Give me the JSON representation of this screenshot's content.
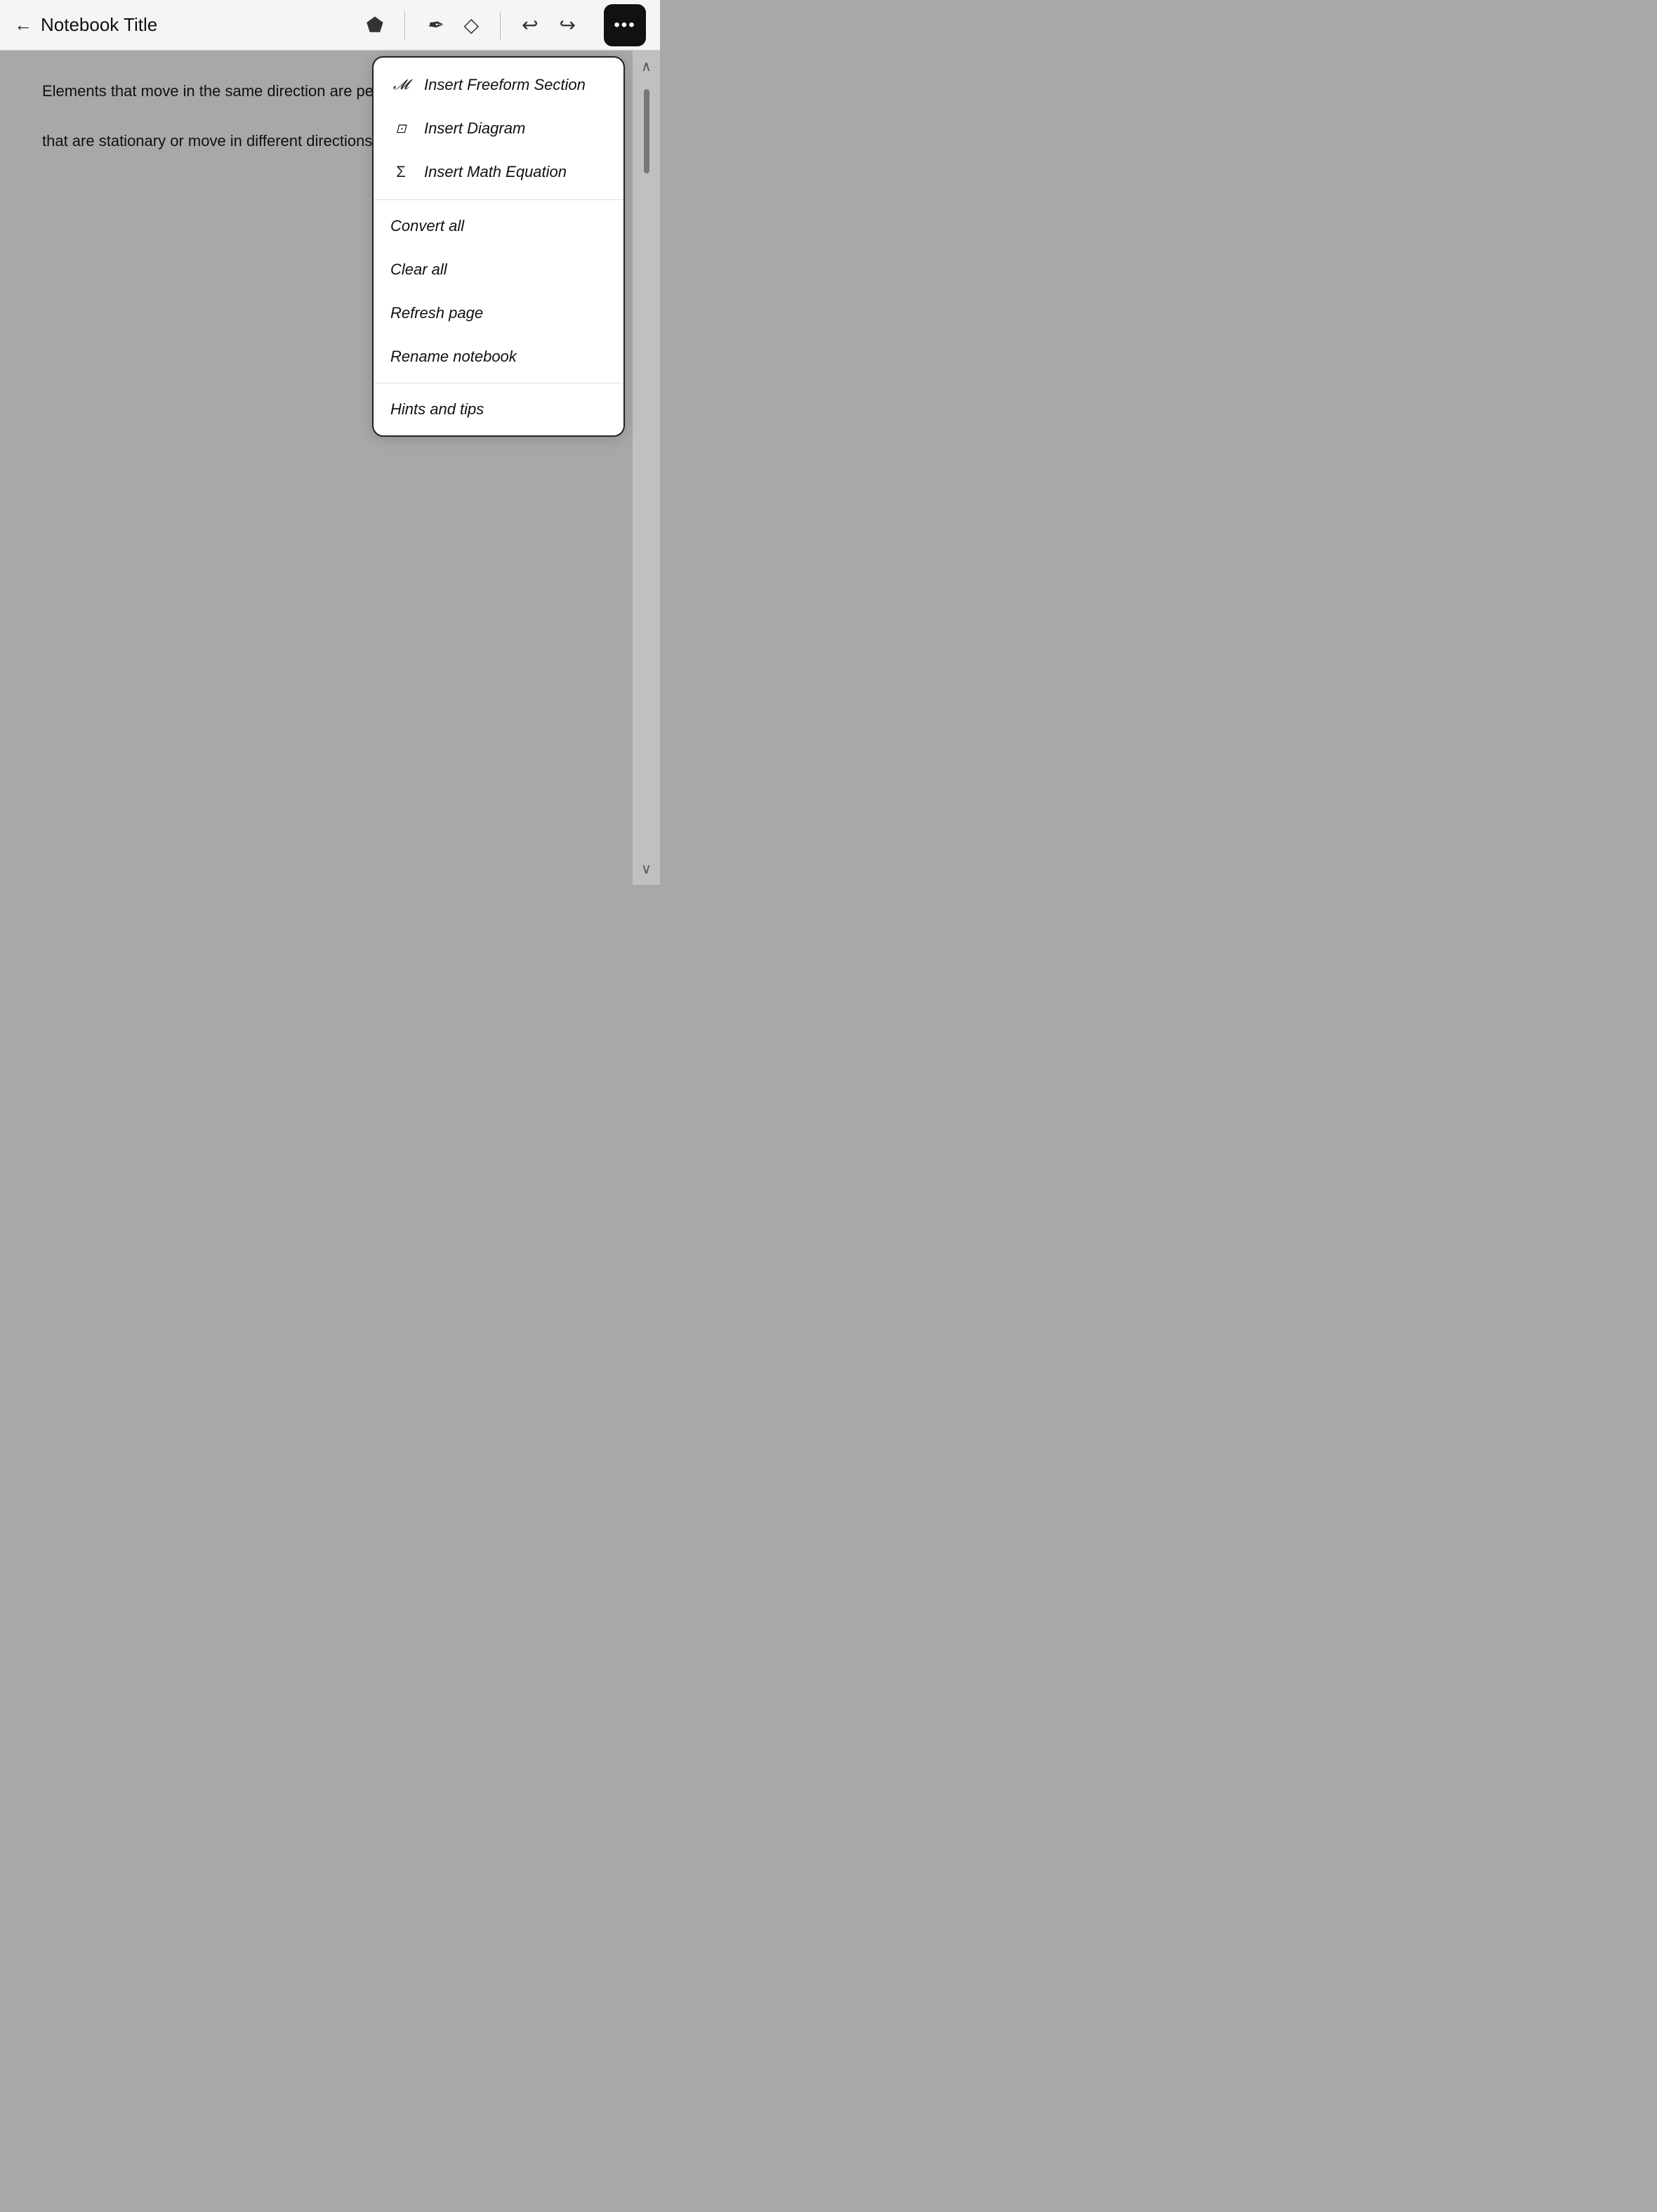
{
  "header": {
    "back_label": "←",
    "title": "Notebook Title",
    "more_dots": "•••"
  },
  "tools": {
    "pen_icon": "✒",
    "eraser_icon": "◇",
    "undo_icon": "↩",
    "redo_icon": "↪",
    "lasso_icon": "⬡"
  },
  "notebook": {
    "text_line1": "Elements that move in the same direction are perc",
    "text_line2": "that are stationary or move in different directions."
  },
  "menu": {
    "insert_freeform_icon": "𝓜",
    "insert_freeform_label": "Insert Freeform Section",
    "insert_diagram_icon": "⊡",
    "insert_diagram_label": "Insert Diagram",
    "insert_math_icon": "Σ",
    "insert_math_label": "Insert Math Equation",
    "convert_all_label": "Convert all",
    "clear_all_label": "Clear all",
    "refresh_page_label": "Refresh page",
    "rename_notebook_label": "Rename notebook",
    "hints_tips_label": "Hints and tips"
  },
  "scrollbar": {
    "up_arrow": "∧",
    "down_arrow": "∨"
  }
}
